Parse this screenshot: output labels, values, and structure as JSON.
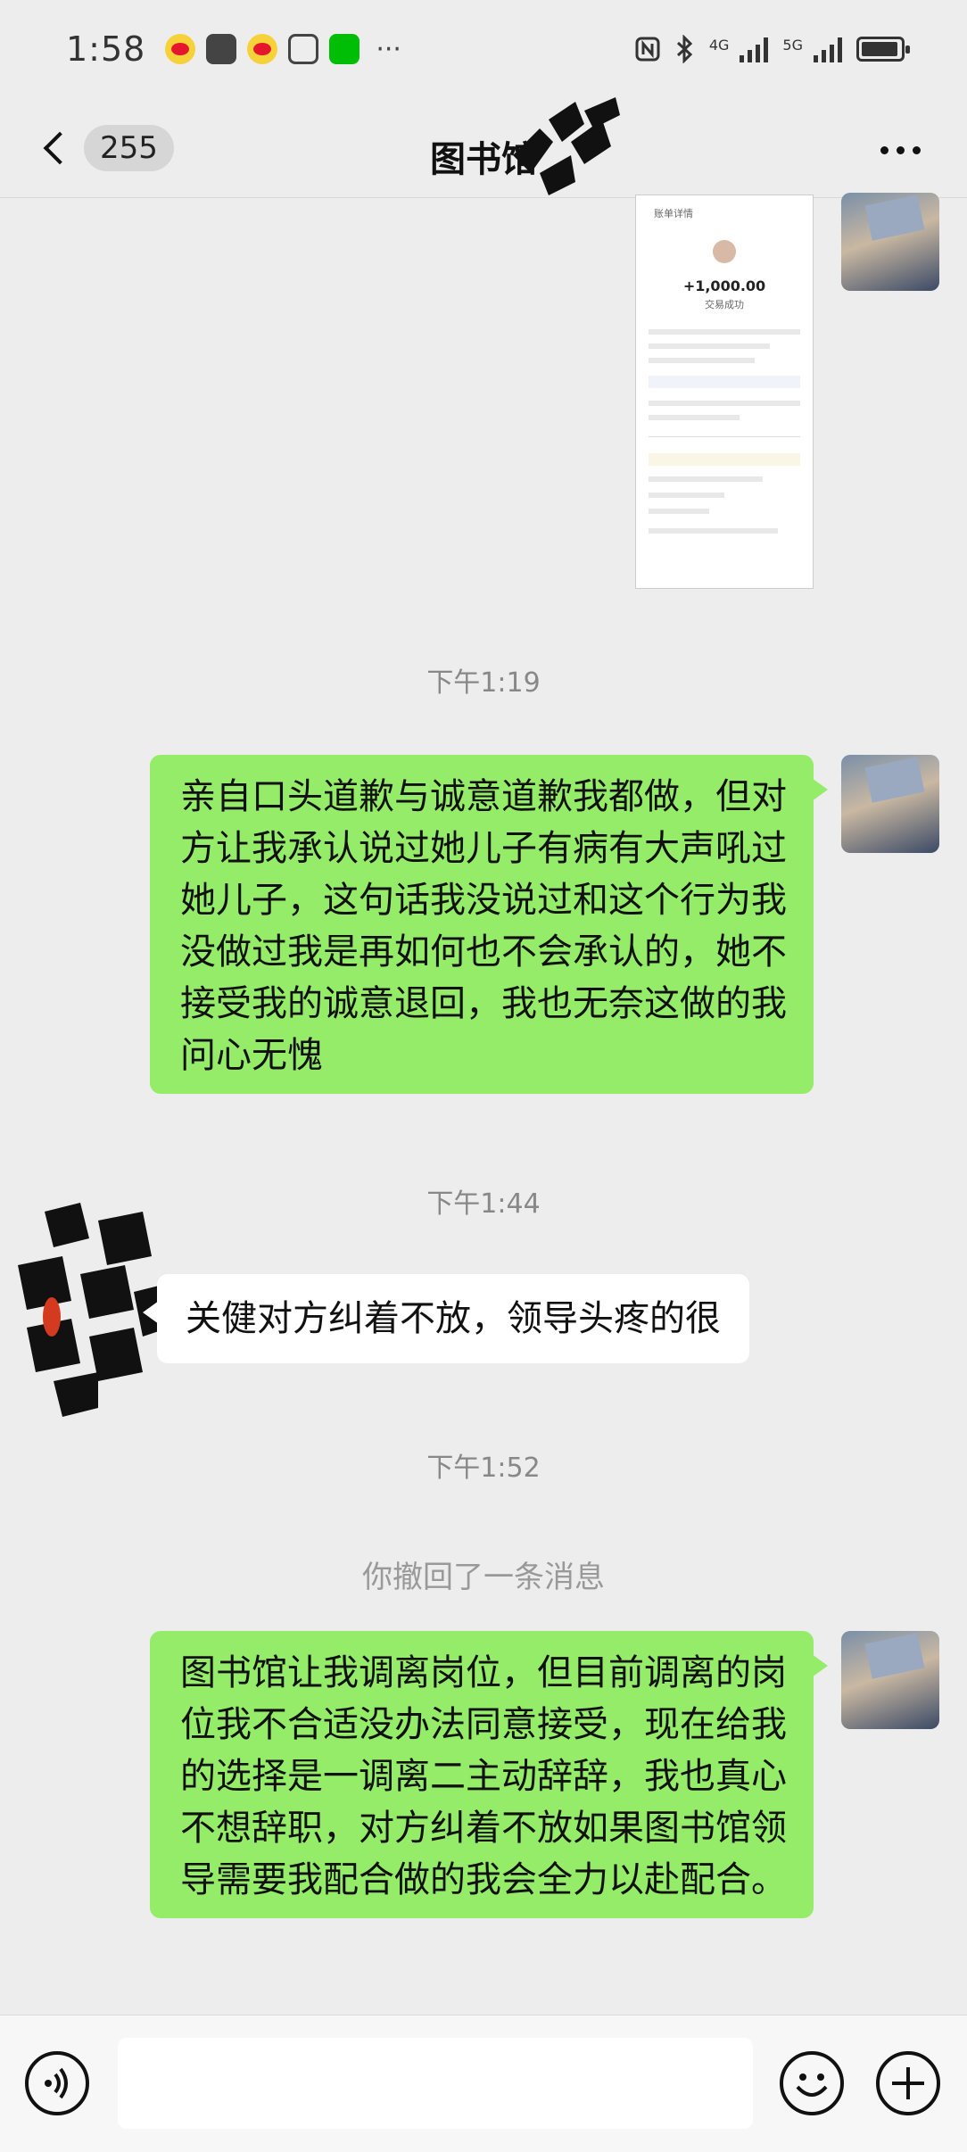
{
  "status_bar": {
    "time": "1:58",
    "apps": [
      "weibo-icon",
      "wallet-icon",
      "weibo-icon",
      "hexagon-app-icon",
      "iqiyi-icon"
    ],
    "more": "···",
    "network_1": "4G",
    "network_2": "5G",
    "colors": {
      "weibo": "#e6162d",
      "iqiyi": "#00be06"
    }
  },
  "nav": {
    "unread_count": "255",
    "title": "图书馆"
  },
  "messages": {
    "image_preview": {
      "header": "账单详情",
      "amount": "+1,000.00",
      "status": "交易成功"
    },
    "time_1": "下午1:19",
    "msg_1": "亲自口头道歉与诚意道歉我都做，但对方让我承认说过她儿子有病有大声吼过她儿子，这句话我没说过和这个行为我没做过我是再如何也不会承认的，她不接受我的诚意退回，我也无奈这做的我问心无愧",
    "time_2": "下午1:44",
    "msg_2": "关健对方纠着不放，领导头疼的很",
    "time_3": "下午1:52",
    "recall": "你撤回了一条消息",
    "msg_3": "图书馆让我调离岗位，但目前调离的岗位我不合适没办法同意接受，现在给我的选择是一调离二主动辞辞，我也真心不想辞职，对方纠着不放如果图书馆领导需要我配合做的我会全力以赴配合。"
  },
  "input_bar": {
    "voice_icon": "voice-icon",
    "emoji_icon": "emoji-icon",
    "plus_icon": "plus-icon"
  },
  "colors": {
    "bubble_out": "#95ec69",
    "bubble_in": "#ffffff",
    "background": "#ededed"
  }
}
